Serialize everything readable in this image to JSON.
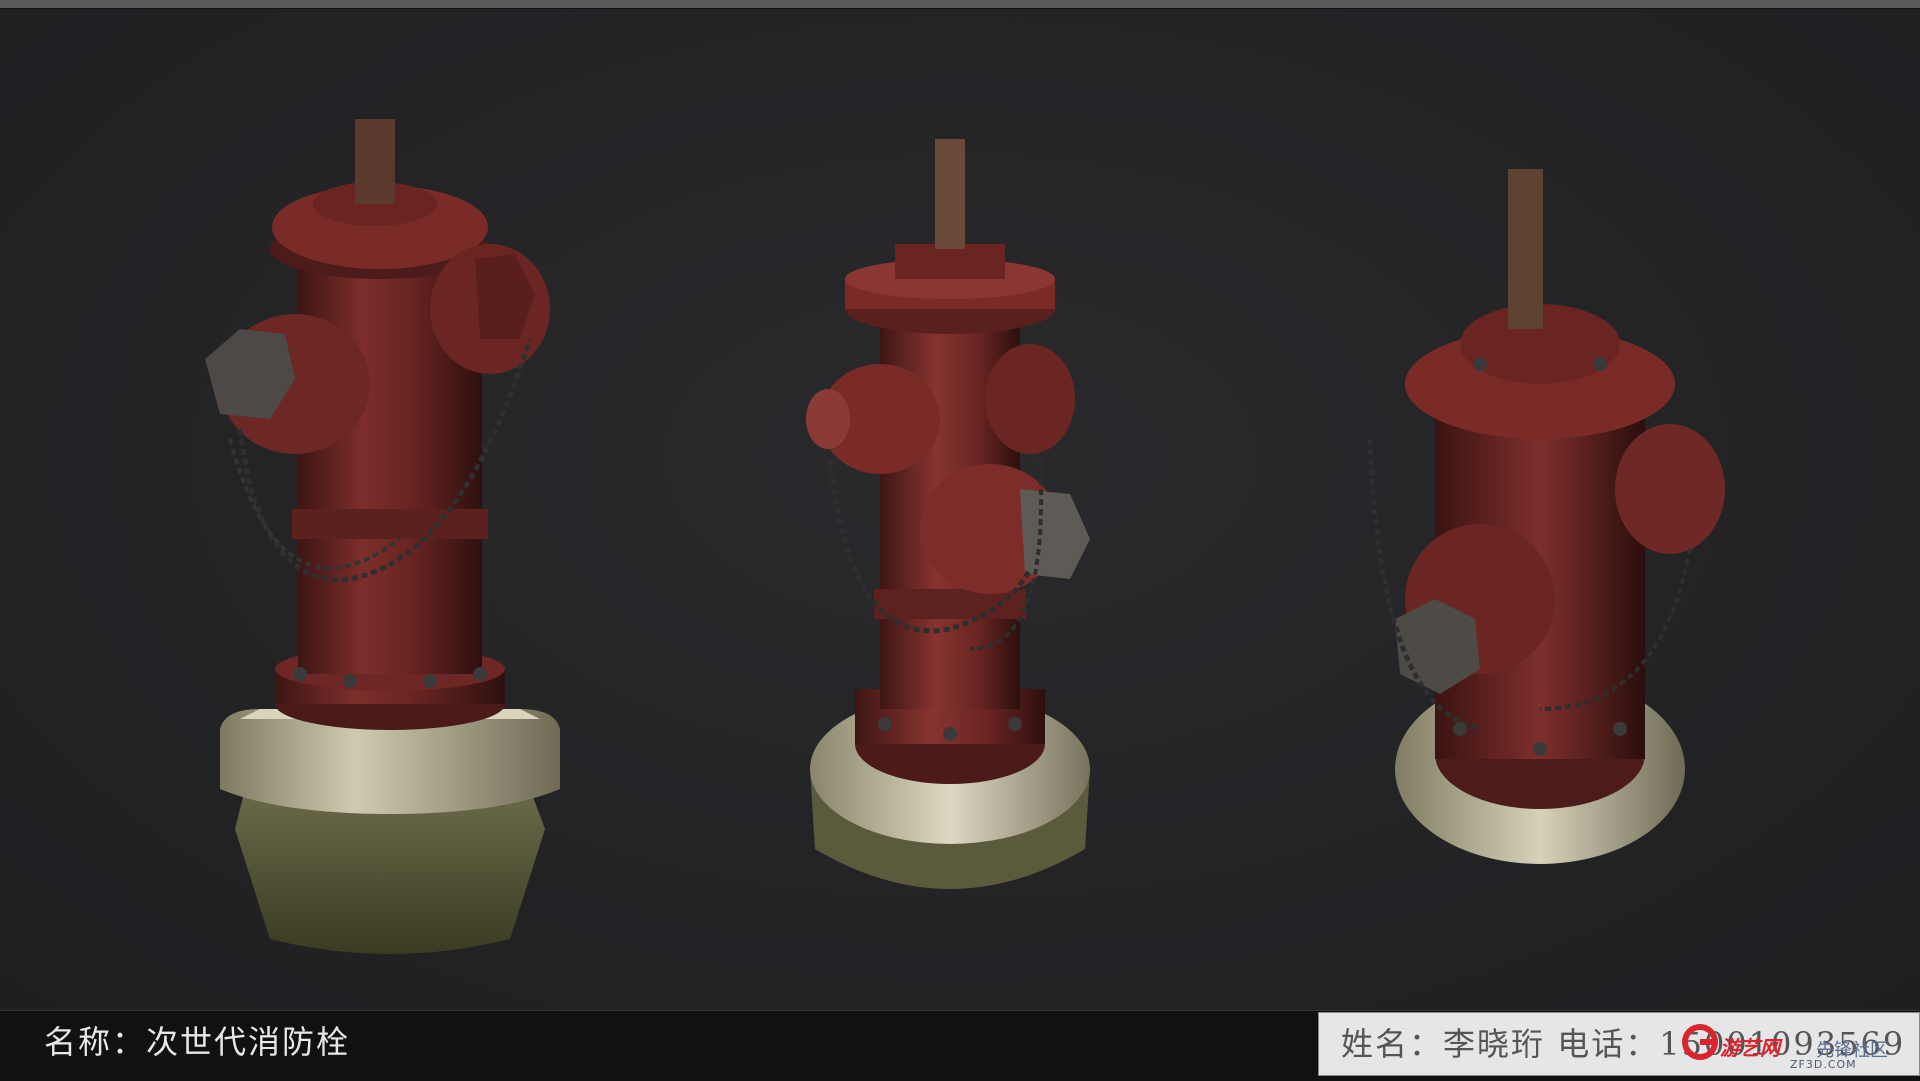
{
  "footer": {
    "name_label": "名称：",
    "name_value": "次世代消防栓",
    "author_label": "姓名：",
    "author_value": "李晓珩",
    "phone_label": "电话：",
    "phone_value": "15001093569"
  },
  "watermark": {
    "site1": "游艺网",
    "site2": "先锋社区",
    "domain": "ZF3D.COM"
  },
  "colors": {
    "background": "#242427",
    "hydrant_red": "#7a2a28",
    "base_stone": "#bdb9a0"
  },
  "renders": [
    {
      "name": "hydrant-view-front-left"
    },
    {
      "name": "hydrant-view-front"
    },
    {
      "name": "hydrant-view-rear-right"
    }
  ]
}
